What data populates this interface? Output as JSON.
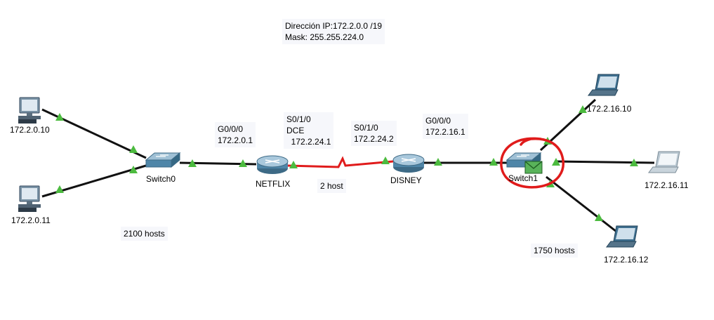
{
  "colors": {
    "link": "#111111",
    "serial_link": "#e01b1b",
    "port_up": "#4cbb3f",
    "highlight_circle": "#e01b1b",
    "device_blue": "#4f86a8",
    "envelope": "#59b35a"
  },
  "annotations": {
    "network": "Dirección IP:172.2.0.0 /19\nMask: 255.255.224.0",
    "netflix_iface": "G0/0/0\n172.2.0.1",
    "netflix_serial": "S0/1/0\nDCE\n  172.2.24.1",
    "disney_serial": "S0/1/0\n172.2.24.2",
    "disney_iface": "G0/0/0\n172.2.16.1",
    "lan0_hosts": "2100 hosts",
    "wan_hosts": "2 host",
    "lan1_hosts": "1750 hosts"
  },
  "devices": {
    "pc0": {
      "label": "172.2.0.10",
      "icon": "desktop-pc-icon"
    },
    "pc1": {
      "label": "172.2.0.11",
      "icon": "desktop-pc-icon"
    },
    "switch0": {
      "label": "Switch0",
      "icon": "switch-icon"
    },
    "netflix": {
      "label": "NETFLIX",
      "icon": "router-icon"
    },
    "disney": {
      "label": "DISNEY",
      "icon": "router-icon"
    },
    "switch1": {
      "label": "Switch1",
      "icon": "switch-icon"
    },
    "laptop0": {
      "label": "172.2.16.10",
      "icon": "laptop-icon"
    },
    "laptop1": {
      "label": "172.2.16.11",
      "icon": "laptop-icon"
    },
    "laptop2": {
      "label": "172.2.16.12",
      "icon": "laptop-icon"
    }
  }
}
